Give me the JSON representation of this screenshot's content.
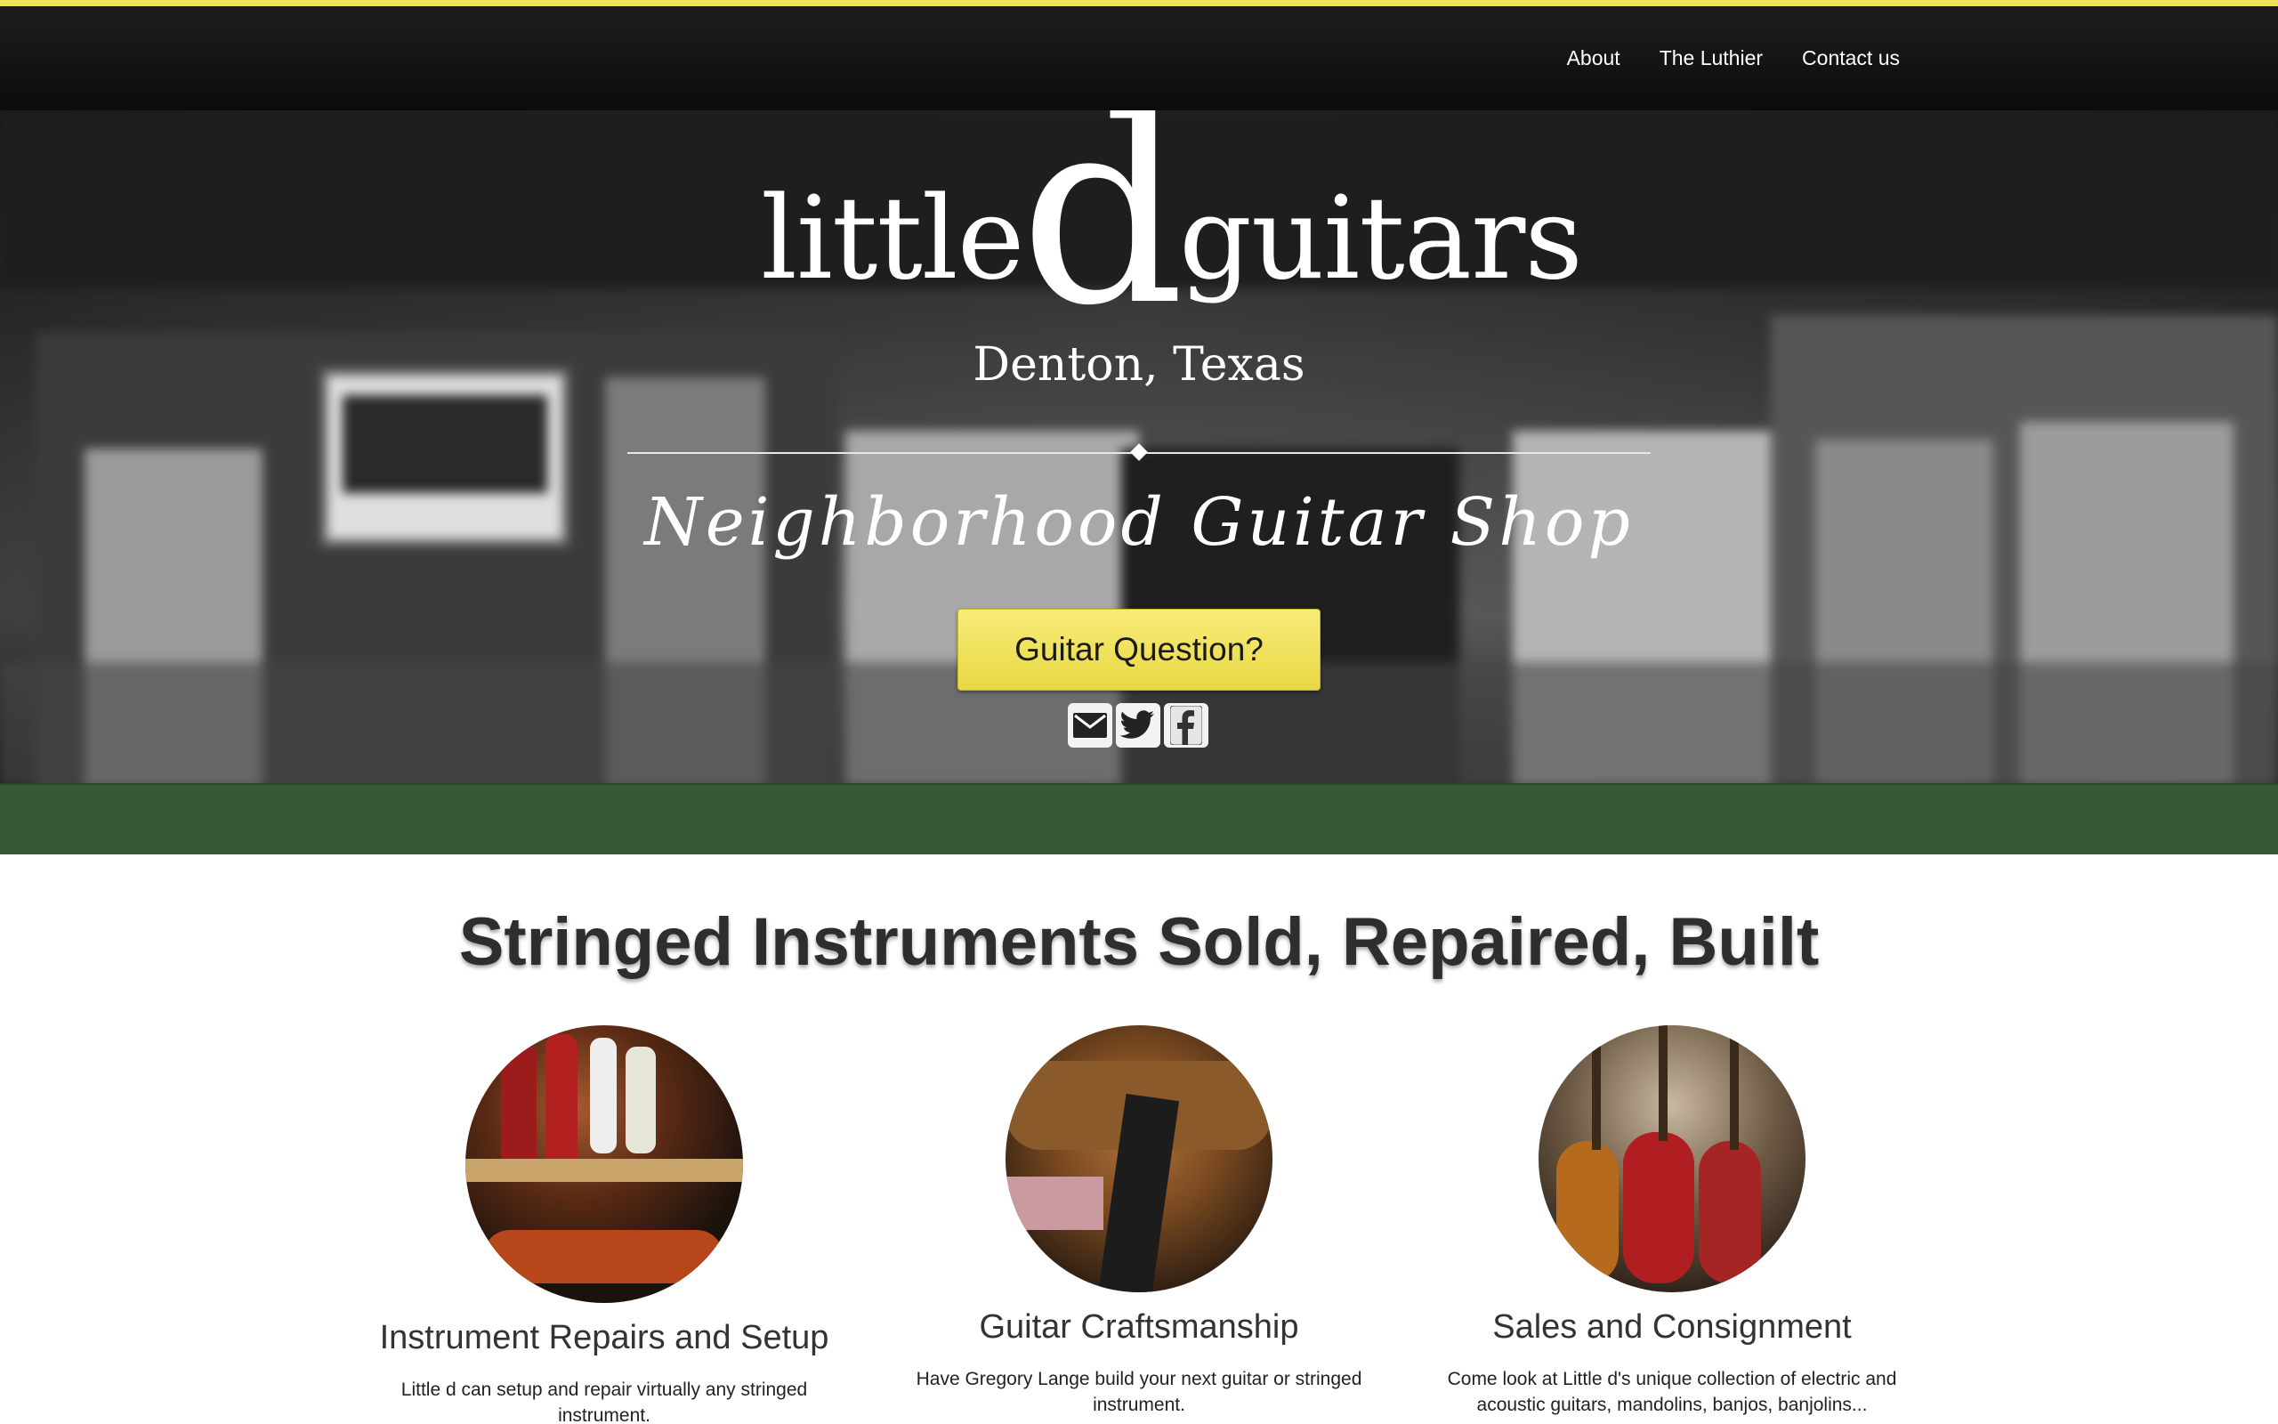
{
  "nav": {
    "links": [
      {
        "label": "About"
      },
      {
        "label": "The Luthier"
      },
      {
        "label": "Contact us"
      }
    ]
  },
  "hero": {
    "logo_little": "little",
    "logo_d": "d",
    "logo_guitars": "guitars",
    "location": "Denton, Texas",
    "tagline": "Neighborhood Guitar Shop",
    "cta_label": "Guitar Question?",
    "social_icons": [
      "email-icon",
      "twitter-icon",
      "facebook-icon"
    ]
  },
  "main": {
    "heading": "Stringed Instruments Sold, Repaired, Built",
    "features": [
      {
        "title": "Instrument Repairs and Setup",
        "text": "Little d can setup and repair virtually any stringed instrument."
      },
      {
        "title": "Guitar Craftsmanship",
        "text": "Have Gregory Lange build your next guitar or stringed instrument."
      },
      {
        "title": "Sales and Consignment",
        "text": "Come look at Little d's unique collection of electric and acoustic guitars, mandolins, banjos, banjolins..."
      }
    ]
  },
  "colors": {
    "accent_yellow": "#f0e35a",
    "nav_bg": "#111111",
    "band_green": "#375a35"
  }
}
